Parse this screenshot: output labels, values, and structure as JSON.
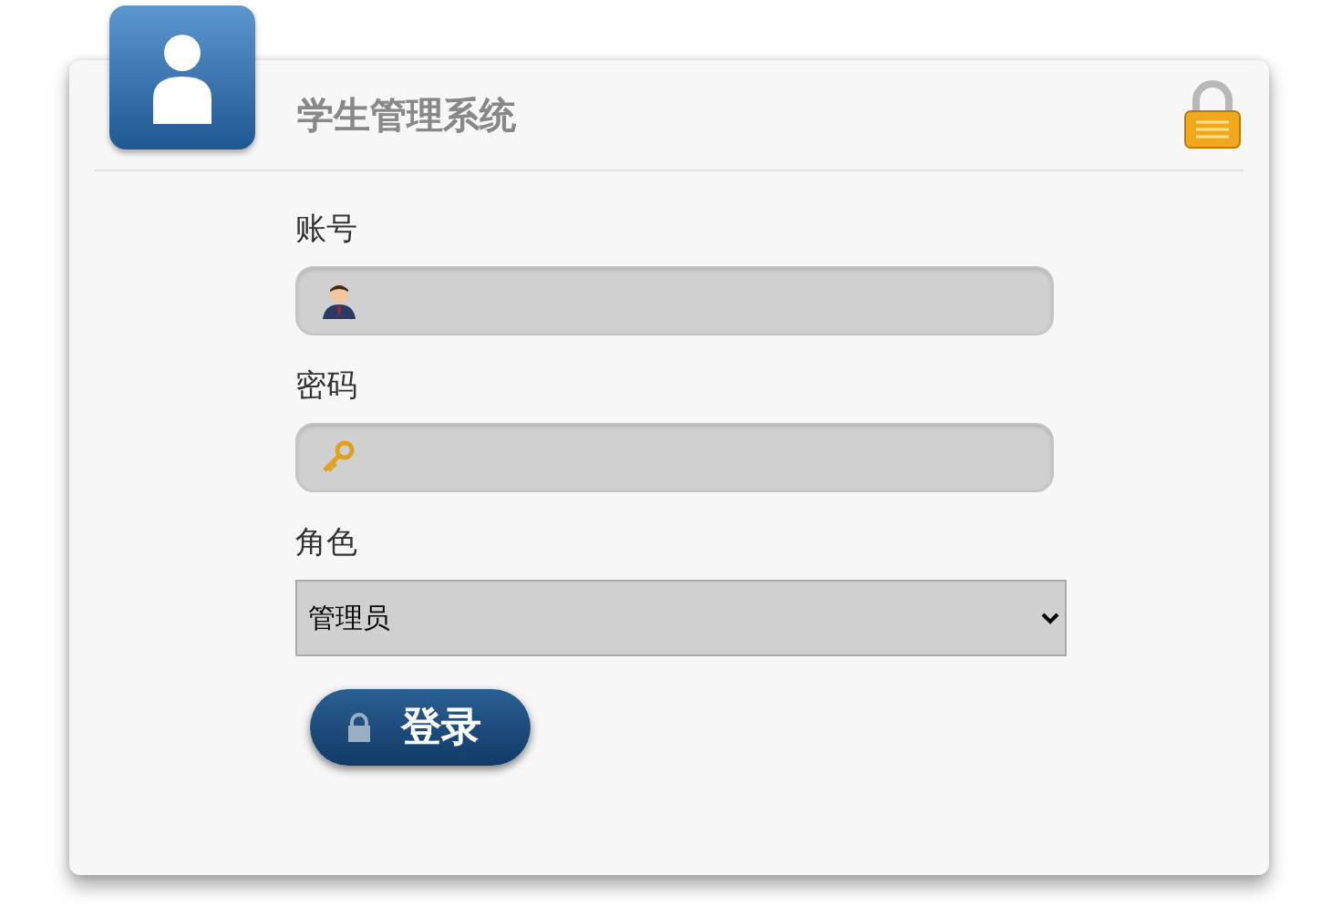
{
  "header": {
    "title": "学生管理系统"
  },
  "form": {
    "fields": [
      {
        "kind": "text",
        "label": "账号"
      },
      {
        "kind": "password",
        "label": "密码"
      },
      {
        "kind": "select",
        "label": "角色",
        "value": "管理员"
      }
    ],
    "submit": "登录"
  }
}
